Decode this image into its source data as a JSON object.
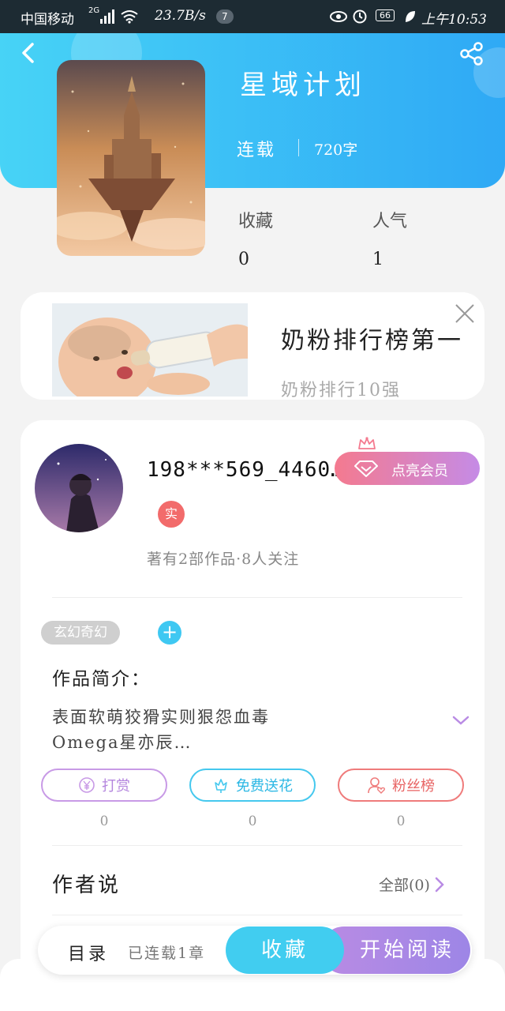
{
  "status_bar": {
    "carrier": "中国移动",
    "network": "2G",
    "speed": "23.7B/s",
    "notification_count": "7",
    "battery": "66",
    "time": "上午10:53"
  },
  "book": {
    "title": "星域计划",
    "status": "连载",
    "word_count": "720字",
    "stats": [
      {
        "label": "收藏",
        "value": "0"
      },
      {
        "label": "人气",
        "value": "1"
      }
    ]
  },
  "ad": {
    "title": "奶粉排行榜第一",
    "subtitle": "奶粉排行10强"
  },
  "author": {
    "name": "198***569_4460…",
    "verified_badge": "实",
    "meta": "著有2部作品·8人关注",
    "vip_button": "点亮会员"
  },
  "tags": [
    "玄幻奇幻"
  ],
  "intro": {
    "label": "作品简介：",
    "line1": "表面软萌狡猾实则狠怨血毒",
    "line2": "Omega星亦辰…"
  },
  "actions": [
    {
      "label": "打赏",
      "count": "0",
      "color": "#c89ae6"
    },
    {
      "label": "免费送花",
      "count": "0",
      "color": "#45c8ee"
    },
    {
      "label": "粉丝榜",
      "count": "0",
      "color": "#ef7b7b"
    }
  ],
  "author_say": {
    "label": "作者说",
    "all_link": "全部(0)"
  },
  "bottom_bar": {
    "catalog": "目录",
    "chapters": "已连载1章",
    "favorite": "收藏",
    "start_reading": "开始阅读"
  },
  "colors": {
    "header_start": "#47d3f6",
    "header_end": "#2fa9f5",
    "accent_purple": "#b98be4",
    "accent_cyan": "#41cdf0"
  }
}
